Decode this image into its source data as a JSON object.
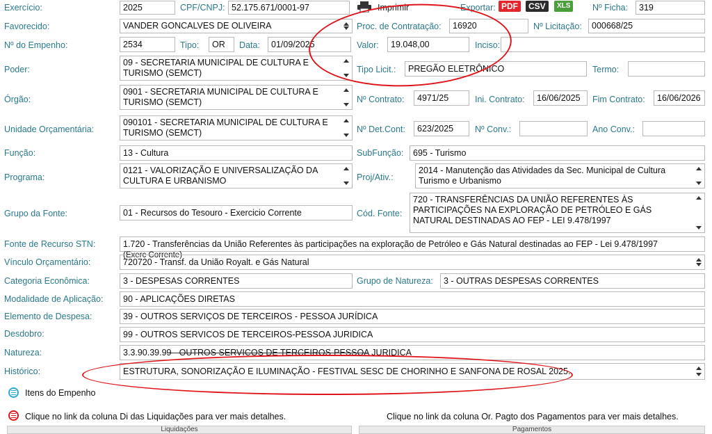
{
  "header": {
    "exercicio_label": "Exercício:",
    "exercicio_value": "2025",
    "cpf_label": "CPF/CNPJ:",
    "cpf_value": "52.175.671/0001-97",
    "imprimir_label": "Imprimir",
    "exportar_label": "Exportar:",
    "pdf": "PDF",
    "csv": "CSV",
    "xls": "XLS",
    "ficha_label": "Nº Ficha:",
    "ficha_value": "319"
  },
  "fields": {
    "favorecido_label": "Favorecido:",
    "favorecido_value": "VANDER GONCALVES DE OLIVEIRA",
    "proc_label": "Proc. de Contratação:",
    "proc_value": "16920",
    "licitacao_label": "Nº Licitação:",
    "licitacao_value": "000668/25",
    "empenho_label": "Nº do Empenho:",
    "empenho_value": "2534",
    "tipo_label": "Tipo:",
    "tipo_value": "OR",
    "data_label": "Data:",
    "data_value": "01/09/2025",
    "valor_label": "Valor:",
    "valor_value": "19.048,00",
    "inciso_label": "Inciso:",
    "inciso_value": "",
    "poder_label": "Poder:",
    "poder_value": "09 - SECRETARIA MUNICIPAL DE CULTURA E TURISMO (SEMCT)",
    "tipolicit_label": "Tipo Licit.:",
    "tipolicit_value": "PREGÃO ELETRÔNICO",
    "termo_label": "Termo:",
    "termo_value": "",
    "orgao_label": "Órgão:",
    "orgao_value": "0901 - SECRETARIA MUNICIPAL DE CULTURA E TURISMO (SEMCT)",
    "contrato_label": "Nº Contrato:",
    "contrato_value": "4971/25",
    "ini_label": "Ini. Contrato:",
    "ini_value": "16/06/2025",
    "fim_label": "Fim Contrato:",
    "fim_value": "16/06/2026",
    "unidade_label": "Unidade Orçamentária:",
    "unidade_value": "090101 - SECRETARIA MUNICIPAL DE CULTURA E TURISMO (SEMCT)",
    "detcont_label": "Nº Det.Cont:",
    "detcont_value": "623/2025",
    "conv_label": "Nº Conv.:",
    "conv_value": "",
    "anoconv_label": "Ano Conv.:",
    "anoconv_value": "",
    "funcao_label": "Função:",
    "funcao_value": "13 - Cultura",
    "subfuncao_label": "SubFunção:",
    "subfuncao_value": "695 - Turismo",
    "programa_label": "Programa:",
    "programa_value": "0121 - VALORIZAÇÃO E UNIVERSALIZAÇÃO DA CULTURA E URBANISMO",
    "projativ_label": "Proj/Ativ.:",
    "projativ_value": "2014 - Manutenção das Atividades da Sec. Municipal de Cultura Turismo e Urbanismo",
    "grupofonte_label": "Grupo da Fonte:",
    "grupofonte_value": "01 - Recursos do Tesouro - Exercicio Corrente",
    "codfonte_label": "Cód. Fonte:",
    "codfonte_value": "720 - TRANSFERÊNCIAS DA UNIÃO REFERENTES ÀS PARTICIPAÇÕES NA EXPLORAÇÃO DE PETRÓLEO E GÁS NATURAL DESTINADAS AO FEP - LEI 9.478/1997",
    "fontestn_label": "Fonte de Recurso STN:",
    "fontestn_value": "1.720 - Transferências da União Referentes às participações na exploração de Petróleo e Gás Natural destinadas ao FEP - Lei 9.478/1997",
    "fontestn_overflow": "(Exerc Corrente)",
    "vinculo_label": "Vínculo Orçamentário:",
    "vinculo_value": "720720 - Transf. da União Royalt. e Gás Natural",
    "categoria_label": "Categoria Econômica:",
    "categoria_value": "3 - DESPESAS CORRENTES",
    "gruponat_label": "Grupo de Natureza:",
    "gruponat_value": "3 - OUTRAS DESPESAS CORRENTES",
    "modalidade_label": "Modalidade de Aplicação:",
    "modalidade_value": "90 - APLICAÇÕES DIRETAS",
    "elemento_label": "Elemento de Despesa:",
    "elemento_value": "39 - OUTROS SERVIÇOS DE TERCEIROS - PESSOA JURÍDICA",
    "desdobro_label": "Desdobro:",
    "desdobro_value": "99 - OUTROS SERVICOS DE TERCEIROS-PESSOA JURIDICA",
    "natureza_label": "Natureza:",
    "natureza_value": "3.3.90.39.99 - OUTROS SERVICOS DE TERCEIROS-PESSOA JURIDICA",
    "historico_label": "Histórico:",
    "historico_value": "ESTRUTURA, SONORIZAÇÃO E ILUMINAÇÃO - FESTIVAL SESC DE CHORINHO E SANFONA DE ROSAL 2025."
  },
  "footer": {
    "itens_label": "Itens do Empenho",
    "liq_hint": "Clique no link da coluna Di das Liquidações para ver mais detalhes.",
    "pag_hint": "Clique no link da coluna Or. Pagto dos Pagamentos para ver mais detalhes.",
    "liq_tab": "Liquidações",
    "pag_tab": "Pagamentos"
  },
  "colors": {
    "label": "#2a7a8c",
    "pdf": "#e3262b",
    "csv": "#2b2b2b",
    "xls": "#4a9e3b",
    "annotation": "#e0151b",
    "accent": "#2fa8d8"
  },
  "icons": {
    "print": "printer-icon",
    "itens": "list-circle-icon",
    "liq": "list-circle-icon"
  }
}
